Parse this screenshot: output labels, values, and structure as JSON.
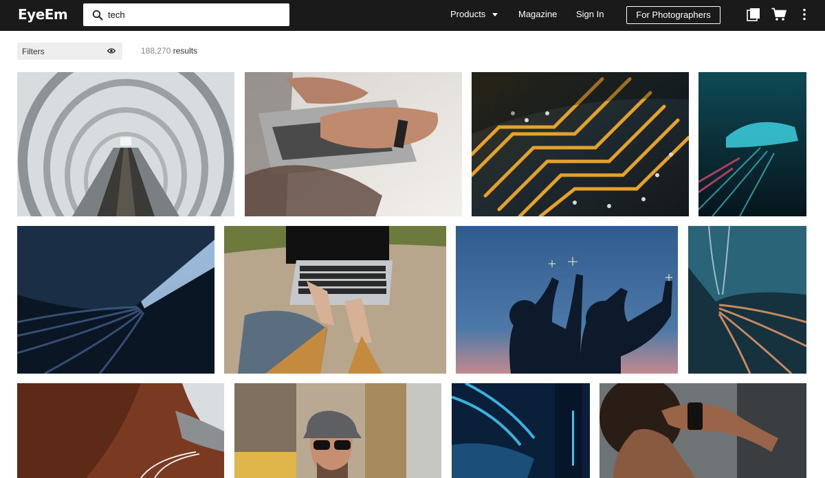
{
  "header": {
    "logo": "EyeEm",
    "search_value": "tech",
    "search_icon": "search-icon",
    "nav": {
      "products": "Products",
      "magazine": "Magazine",
      "sign_in": "Sign In"
    },
    "photographers_button": "For Photographers",
    "icons": [
      "collections-icon",
      "cart-icon",
      "more-vertical-icon"
    ]
  },
  "toolbar": {
    "filters_label": "Filters",
    "filters_icon": "eye-icon",
    "results_count": "188,270",
    "results_label": "results"
  },
  "colors": {
    "header_bg": "#1a1a1a",
    "filter_bg": "#eeeeee"
  },
  "photos": [
    "escalator-tunnel-photo",
    "hands-typing-laptop-photo",
    "circuit-board-photo",
    "blue-light-car-photo",
    "blue-tunnel-motion-photo",
    "laptop-on-blanket-photo",
    "sparklers-silhouette-photo",
    "train-motion-blur-photo",
    "coastal-road-light-trails-photo",
    "man-sunglasses-city-photo",
    "neon-blue-lights-photo",
    "woman-smartwatch-photo"
  ]
}
